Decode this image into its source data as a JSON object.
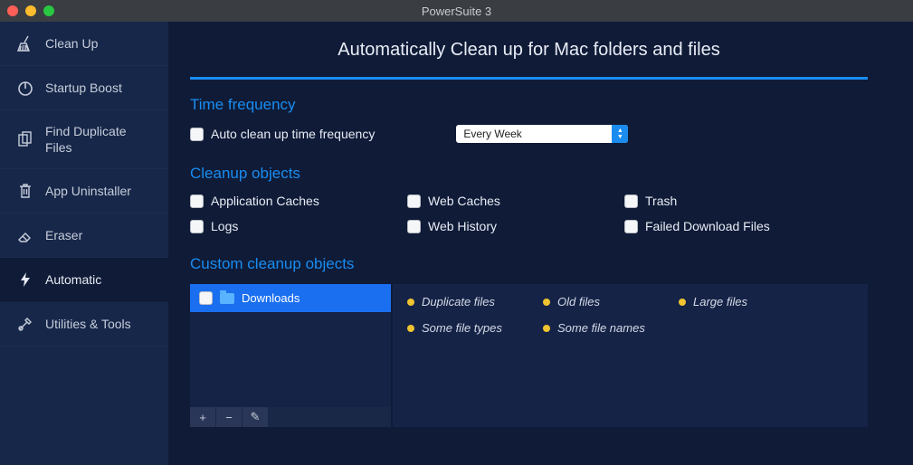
{
  "window": {
    "title": "PowerSuite 3"
  },
  "sidebar": {
    "items": [
      {
        "label": "Clean Up"
      },
      {
        "label": "Startup Boost"
      },
      {
        "label": "Find Duplicate Files"
      },
      {
        "label": "App Uninstaller"
      },
      {
        "label": "Eraser"
      },
      {
        "label": "Automatic"
      },
      {
        "label": "Utilities & Tools"
      }
    ],
    "active_index": 5
  },
  "main": {
    "title": "Automatically Clean up for Mac folders and files",
    "sections": {
      "time_frequency": {
        "heading": "Time frequency",
        "checkbox_label": "Auto clean up time frequency",
        "select_value": "Every Week"
      },
      "cleanup_objects": {
        "heading": "Cleanup objects",
        "items": [
          "Application Caches",
          "Web Caches",
          "Trash",
          "Logs",
          "Web History",
          "Failed Download Files"
        ]
      },
      "custom_cleanup": {
        "heading": "Custom cleanup objects",
        "folders": [
          {
            "name": "Downloads"
          }
        ],
        "filters": [
          "Duplicate files",
          "Old files",
          "Large files",
          "Some file types",
          "Some file names"
        ],
        "toolbar": {
          "add": "+",
          "remove": "−",
          "edit": "✎"
        }
      }
    }
  }
}
